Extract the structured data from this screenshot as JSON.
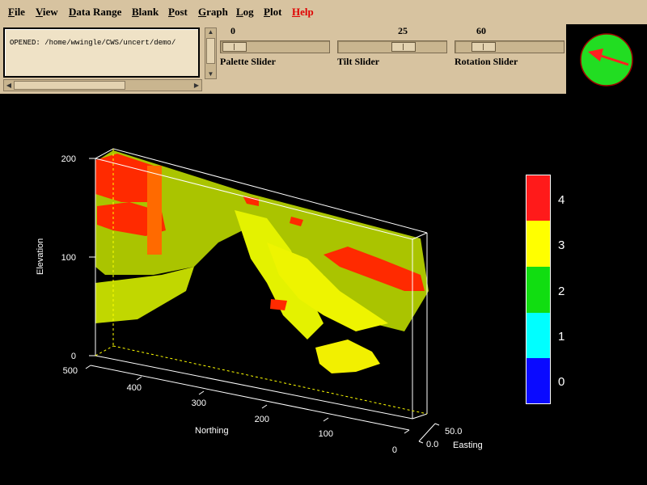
{
  "menu": {
    "items": [
      "File",
      "View",
      "Data Range",
      "Blank",
      "Post",
      "Graph",
      "Log",
      "Plot",
      "Help"
    ]
  },
  "message_box": {
    "text": "OPENED: /home/wwingle/CWS/uncert/demo/"
  },
  "sliders": {
    "palette": {
      "label": "Palette Slider",
      "value": "0"
    },
    "tilt": {
      "label": "Tilt Slider",
      "value": "25"
    },
    "rotation": {
      "label": "Rotation Slider",
      "value": "60"
    }
  },
  "compass": {
    "icon": "compass-arrow-icon",
    "background": "#22dd22",
    "arrow_color": "#ff2020"
  },
  "plot": {
    "ylabel": "Elevation",
    "xlabel": "Northing",
    "zlabel": "Easting",
    "elevation_ticks": [
      "200",
      "100",
      "0"
    ],
    "northing_ticks": [
      "500",
      "400",
      "300",
      "200",
      "100",
      "0"
    ],
    "easting_ticks": [
      "0.0",
      "50.0"
    ]
  },
  "legend": {
    "entries": [
      {
        "label": "4",
        "color": "#ff1a1a"
      },
      {
        "label": "3",
        "color": "#ffff00"
      },
      {
        "label": "2",
        "color": "#11dd11"
      },
      {
        "label": "1",
        "color": "#00ffff"
      },
      {
        "label": "0",
        "color": "#0a0aff"
      }
    ]
  }
}
